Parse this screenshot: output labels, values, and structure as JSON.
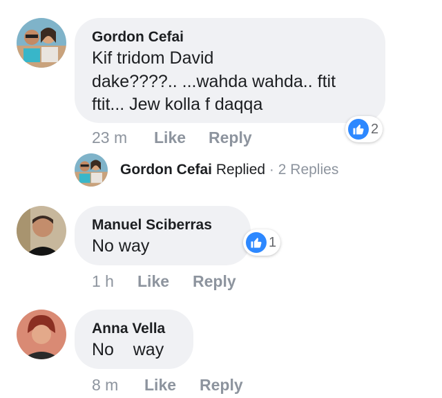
{
  "comments": [
    {
      "author": "Gordon Cefai",
      "text_lines": [
        "Kif tridom David",
        "dake????.. ...wahda wahda.. ftit",
        "ftit... Jew kolla f daqqa"
      ],
      "time": "23 m",
      "like_label": "Like",
      "reply_label": "Reply",
      "reaction_count": "2"
    },
    {
      "author": "Manuel Sciberras",
      "text_lines": [
        "No way"
      ],
      "time": "1 h",
      "like_label": "Like",
      "reply_label": "Reply",
      "reaction_count": "1"
    },
    {
      "author": "Anna Vella",
      "text_lines": [
        "No    way"
      ],
      "time": "8 m",
      "like_label": "Like",
      "reply_label": "Reply"
    }
  ],
  "replies_row": {
    "name": "Gordon Cefai",
    "action": "Replied",
    "separator": "·",
    "count": "2 Replies"
  },
  "colors": {
    "bubble": "#f0f1f4",
    "meta_gray": "#8d949e",
    "like_blue": "#2d88ff"
  },
  "icons": {
    "reaction": "thumbs-up-icon"
  }
}
